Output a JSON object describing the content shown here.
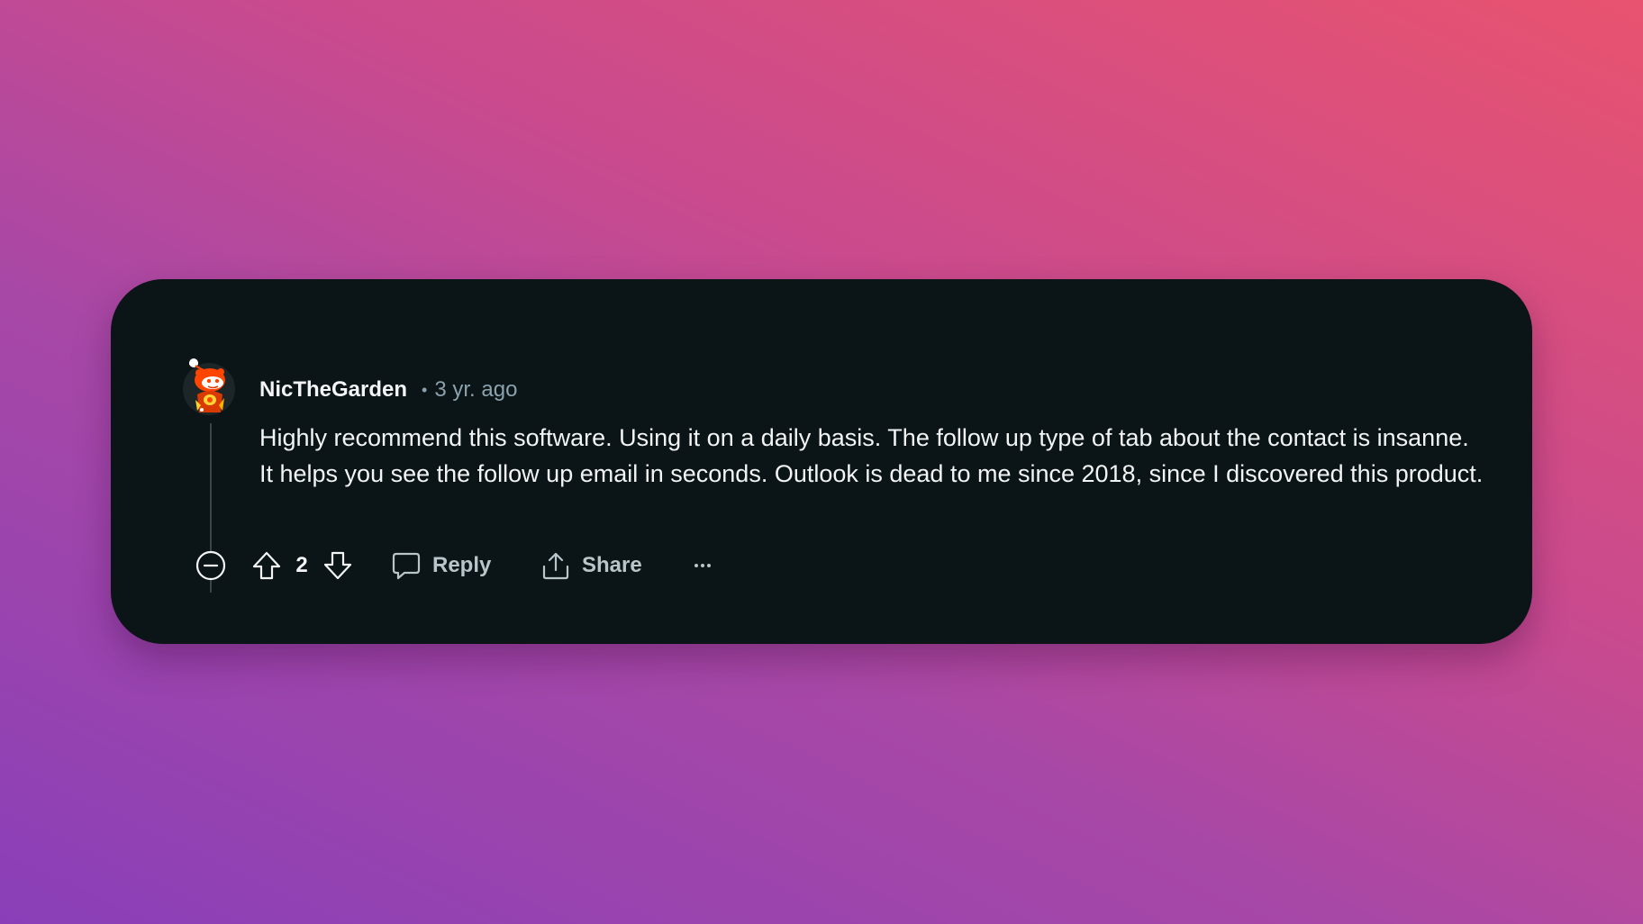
{
  "comment": {
    "author": "NicTheGarden",
    "separator": "•",
    "timestamp": "3 yr. ago",
    "body": "Highly recommend this software. Using it on a daily basis. The follow up type of tab about the contact is insanne. It helps you see the follow up email in seconds. Outlook is dead to me since 2018, since I discovered this product.",
    "score": "2"
  },
  "actions": {
    "collapse_icon": "minus-circle-icon",
    "upvote_icon": "arrow-up-icon",
    "downvote_icon": "arrow-down-icon",
    "reply_label": "Reply",
    "reply_icon": "speech-bubble-icon",
    "share_label": "Share",
    "share_icon": "share-upload-icon",
    "more_icon": "ellipsis-icon"
  },
  "colors": {
    "card_background": "#0b1416",
    "primary_text": "#f2f4f5",
    "secondary_text": "#8ba2ad",
    "avatar_accent": "#ff4500"
  }
}
